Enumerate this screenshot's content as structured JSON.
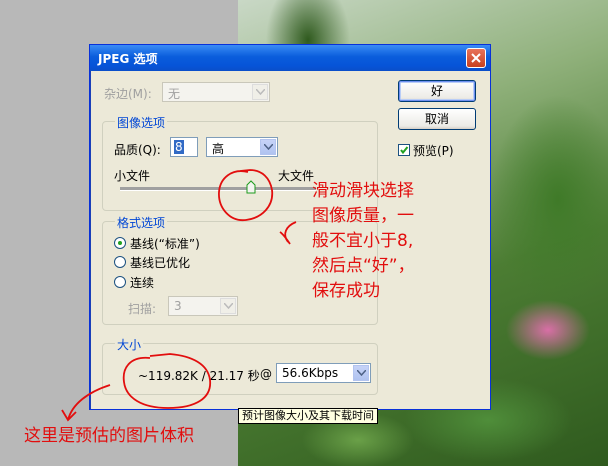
{
  "dialog": {
    "title": "JPEG 选项",
    "matte_label": "杂边(M):",
    "matte_value": "无",
    "image_options_legend": "图像选项",
    "quality_label": "品质(Q):",
    "quality_value": "8",
    "quality_level": "高",
    "small_file_label": "小文件",
    "large_file_label": "大文件",
    "format_options_legend": "格式选项",
    "format_options": [
      {
        "label": "基线(“标准”)",
        "selected": true
      },
      {
        "label": "基线已优化",
        "selected": false
      },
      {
        "label": "连续",
        "selected": false
      }
    ],
    "scan_label": "扫描:",
    "scan_value": "3",
    "size_legend": "大小",
    "size_estimate": "~119.82K / 21.17 秒",
    "at_label": "@",
    "speed_value": "56.6Kbps",
    "ok_button": "好",
    "cancel_button": "取消",
    "preview_label": "预览(P)",
    "preview_checked": true,
    "quality_slider_fraction": 0.67
  },
  "tooltip": "预计图像大小及其下载时间",
  "annotations": {
    "right_note": [
      "滑动滑块选择",
      "图像质量，一",
      "般不宜小于8,",
      "然后点“好”，",
      "保存成功"
    ],
    "bottom_note": "这里是预估的图片体积"
  },
  "colors": {
    "annotation_red": "#e20e0e",
    "titlebar_blue": "#0a5ddc",
    "dialog_bg": "#ece9d8",
    "legend_blue": "#0046d5"
  }
}
